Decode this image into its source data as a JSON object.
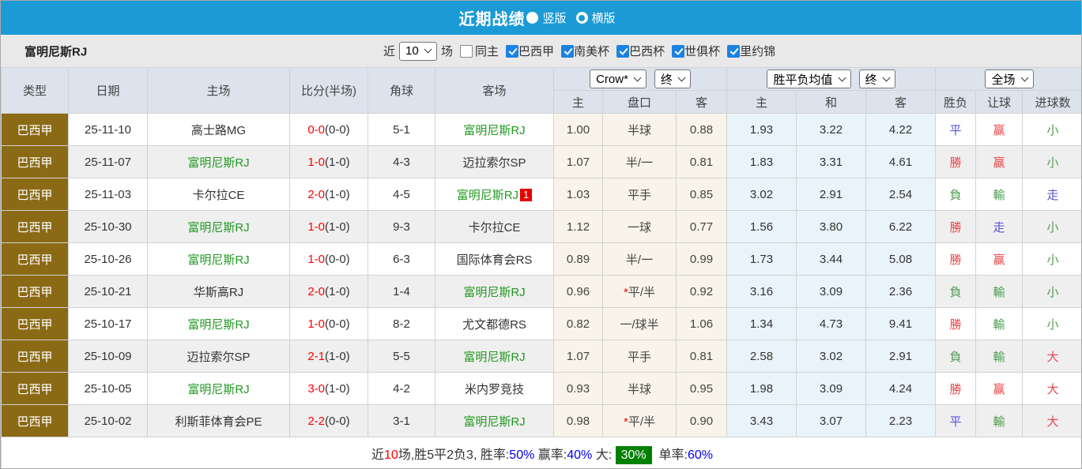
{
  "title_bar": {
    "title": "近期战绩",
    "options": [
      {
        "label": "竖版",
        "checked": false
      },
      {
        "label": "横版",
        "checked": true
      }
    ]
  },
  "filter_bar": {
    "team_name": "富明尼斯RJ",
    "recent_label": "近",
    "recent_value": "10",
    "matches_label": "场",
    "same_home": {
      "label": "同主",
      "checked": false
    },
    "competitions": [
      {
        "label": "巴西甲",
        "checked": true
      },
      {
        "label": "南美杯",
        "checked": true
      },
      {
        "label": "巴西杯",
        "checked": true
      },
      {
        "label": "世俱杯",
        "checked": true
      },
      {
        "label": "里约锦",
        "checked": true
      }
    ]
  },
  "table": {
    "selects": {
      "odds_company": "Crow*",
      "odds_time_1": "终",
      "avg_label": "胜平负均值",
      "odds_time_2": "终",
      "scope": "全场"
    },
    "columns": {
      "type": "类型",
      "date": "日期",
      "home": "主场",
      "score": "比分(半场)",
      "corners": "角球",
      "away": "客场",
      "odds_home": "主",
      "odds_handicap": "盘口",
      "odds_away": "客",
      "avg_home": "主",
      "avg_draw": "和",
      "avg_away": "客",
      "result_outcome": "胜负",
      "result_handicap": "让球",
      "result_goals": "进球数"
    },
    "rows": [
      {
        "league": "巴西甲",
        "date": "25-11-10",
        "home": {
          "name": "高士路MG",
          "self": false,
          "badge": ""
        },
        "away": {
          "name": "富明尼斯RJ",
          "self": true,
          "badge": ""
        },
        "score": {
          "ft": "0-0",
          "ht": "(0-0)"
        },
        "corners": "5-1",
        "odds": {
          "home": "1.00",
          "star": false,
          "handicap": "半球",
          "away": "0.88"
        },
        "avg": {
          "home": "1.93",
          "draw": "3.22",
          "away": "4.22"
        },
        "results": [
          {
            "text": "平",
            "color": "blue"
          },
          {
            "text": "赢",
            "color": "red"
          },
          {
            "text": "小",
            "color": "green"
          }
        ]
      },
      {
        "league": "巴西甲",
        "date": "25-11-07",
        "home": {
          "name": "富明尼斯RJ",
          "self": true,
          "badge": ""
        },
        "away": {
          "name": "迈拉索尔SP",
          "self": false,
          "badge": ""
        },
        "score": {
          "ft": "1-0",
          "ht": "(1-0)"
        },
        "corners": "4-3",
        "odds": {
          "home": "1.07",
          "star": false,
          "handicap": "半/一",
          "away": "0.81"
        },
        "avg": {
          "home": "1.83",
          "draw": "3.31",
          "away": "4.61"
        },
        "results": [
          {
            "text": "勝",
            "color": "red"
          },
          {
            "text": "赢",
            "color": "red"
          },
          {
            "text": "小",
            "color": "green"
          }
        ]
      },
      {
        "league": "巴西甲",
        "date": "25-11-03",
        "home": {
          "name": "卡尔拉CE",
          "self": false,
          "badge": ""
        },
        "away": {
          "name": "富明尼斯RJ",
          "self": true,
          "badge": "1"
        },
        "score": {
          "ft": "2-0",
          "ht": "(1-0)"
        },
        "corners": "4-5",
        "odds": {
          "home": "1.03",
          "star": false,
          "handicap": "平手",
          "away": "0.85"
        },
        "avg": {
          "home": "3.02",
          "draw": "2.91",
          "away": "2.54"
        },
        "results": [
          {
            "text": "負",
            "color": "green"
          },
          {
            "text": "輸",
            "color": "green"
          },
          {
            "text": "走",
            "color": "blue"
          }
        ]
      },
      {
        "league": "巴西甲",
        "date": "25-10-30",
        "home": {
          "name": "富明尼斯RJ",
          "self": true,
          "badge": ""
        },
        "away": {
          "name": "卡尔拉CE",
          "self": false,
          "badge": ""
        },
        "score": {
          "ft": "1-0",
          "ht": "(1-0)"
        },
        "corners": "9-3",
        "odds": {
          "home": "1.12",
          "star": false,
          "handicap": "一球",
          "away": "0.77"
        },
        "avg": {
          "home": "1.56",
          "draw": "3.80",
          "away": "6.22"
        },
        "results": [
          {
            "text": "勝",
            "color": "red"
          },
          {
            "text": "走",
            "color": "blue"
          },
          {
            "text": "小",
            "color": "green"
          }
        ]
      },
      {
        "league": "巴西甲",
        "date": "25-10-26",
        "home": {
          "name": "富明尼斯RJ",
          "self": true,
          "badge": ""
        },
        "away": {
          "name": "国际体育会RS",
          "self": false,
          "badge": ""
        },
        "score": {
          "ft": "1-0",
          "ht": "(0-0)"
        },
        "corners": "6-3",
        "odds": {
          "home": "0.89",
          "star": false,
          "handicap": "半/一",
          "away": "0.99"
        },
        "avg": {
          "home": "1.73",
          "draw": "3.44",
          "away": "5.08"
        },
        "results": [
          {
            "text": "勝",
            "color": "red"
          },
          {
            "text": "赢",
            "color": "red"
          },
          {
            "text": "小",
            "color": "green"
          }
        ]
      },
      {
        "league": "巴西甲",
        "date": "25-10-21",
        "home": {
          "name": "华斯高RJ",
          "self": false,
          "badge": ""
        },
        "away": {
          "name": "富明尼斯RJ",
          "self": true,
          "badge": ""
        },
        "score": {
          "ft": "2-0",
          "ht": "(1-0)"
        },
        "corners": "1-4",
        "odds": {
          "home": "0.96",
          "star": true,
          "handicap": "平/半",
          "away": "0.92"
        },
        "avg": {
          "home": "3.16",
          "draw": "3.09",
          "away": "2.36"
        },
        "results": [
          {
            "text": "負",
            "color": "green"
          },
          {
            "text": "輸",
            "color": "green"
          },
          {
            "text": "小",
            "color": "green"
          }
        ]
      },
      {
        "league": "巴西甲",
        "date": "25-10-17",
        "home": {
          "name": "富明尼斯RJ",
          "self": true,
          "badge": ""
        },
        "away": {
          "name": "尤文都德RS",
          "self": false,
          "badge": ""
        },
        "score": {
          "ft": "1-0",
          "ht": "(0-0)"
        },
        "corners": "8-2",
        "odds": {
          "home": "0.82",
          "star": false,
          "handicap": "一/球半",
          "away": "1.06"
        },
        "avg": {
          "home": "1.34",
          "draw": "4.73",
          "away": "9.41"
        },
        "results": [
          {
            "text": "勝",
            "color": "red"
          },
          {
            "text": "輸",
            "color": "green"
          },
          {
            "text": "小",
            "color": "green"
          }
        ]
      },
      {
        "league": "巴西甲",
        "date": "25-10-09",
        "home": {
          "name": "迈拉索尔SP",
          "self": false,
          "badge": ""
        },
        "away": {
          "name": "富明尼斯RJ",
          "self": true,
          "badge": ""
        },
        "score": {
          "ft": "2-1",
          "ht": "(1-0)"
        },
        "corners": "5-5",
        "odds": {
          "home": "1.07",
          "star": false,
          "handicap": "平手",
          "away": "0.81"
        },
        "avg": {
          "home": "2.58",
          "draw": "3.02",
          "away": "2.91"
        },
        "results": [
          {
            "text": "負",
            "color": "green"
          },
          {
            "text": "輸",
            "color": "green"
          },
          {
            "text": "大",
            "color": "red"
          }
        ]
      },
      {
        "league": "巴西甲",
        "date": "25-10-05",
        "home": {
          "name": "富明尼斯RJ",
          "self": true,
          "badge": ""
        },
        "away": {
          "name": "米内罗竞技",
          "self": false,
          "badge": ""
        },
        "score": {
          "ft": "3-0",
          "ht": "(1-0)"
        },
        "corners": "4-2",
        "odds": {
          "home": "0.93",
          "star": false,
          "handicap": "半球",
          "away": "0.95"
        },
        "avg": {
          "home": "1.98",
          "draw": "3.09",
          "away": "4.24"
        },
        "results": [
          {
            "text": "勝",
            "color": "red"
          },
          {
            "text": "赢",
            "color": "red"
          },
          {
            "text": "大",
            "color": "red"
          }
        ]
      },
      {
        "league": "巴西甲",
        "date": "25-10-02",
        "home": {
          "name": "利斯菲体育会PE",
          "self": false,
          "badge": ""
        },
        "away": {
          "name": "富明尼斯RJ",
          "self": true,
          "badge": ""
        },
        "score": {
          "ft": "2-2",
          "ht": "(0-0)"
        },
        "corners": "3-1",
        "odds": {
          "home": "0.98",
          "star": true,
          "handicap": "平/半",
          "away": "0.90"
        },
        "avg": {
          "home": "3.43",
          "draw": "3.07",
          "away": "2.23"
        },
        "results": [
          {
            "text": "平",
            "color": "blue"
          },
          {
            "text": "輸",
            "color": "green"
          },
          {
            "text": "大",
            "color": "red"
          }
        ]
      }
    ]
  },
  "footer": {
    "parts": [
      {
        "text": "近",
        "style": "plain"
      },
      {
        "text": "10",
        "style": "red"
      },
      {
        "text": "场,胜5平2负3, ",
        "style": "plain"
      },
      {
        "text": "胜率:",
        "style": "plain"
      },
      {
        "text": "50%",
        "style": "blue"
      },
      {
        "text": " 赢率:",
        "style": "plain"
      },
      {
        "text": "40%",
        "style": "blue"
      },
      {
        "text": " 大: ",
        "style": "plain"
      },
      {
        "text": "30%",
        "style": "badge"
      },
      {
        "text": "  单率:",
        "style": "plain"
      },
      {
        "text": "60%",
        "style": "blue"
      }
    ]
  },
  "colors": {
    "titlebar_blue": "#1b9ad6",
    "checkbox_blue": "#1b82e2",
    "league_gold": "#8b6a15",
    "header_bg": "#dce3ed",
    "stripe_gray": "#efefef",
    "odds_cream_bg": "#f8f4e9",
    "avg_blue_bg": "#e9f3fa",
    "self_team_green": "#229922",
    "score_red": "#ff0000",
    "card_badge_red": "#e60000",
    "result_red": "#e9464a",
    "result_blue": "#5652d6",
    "result_green": "#4e9e50",
    "rate_blue": "#0000ee",
    "rate_badge_green": "#008000"
  }
}
